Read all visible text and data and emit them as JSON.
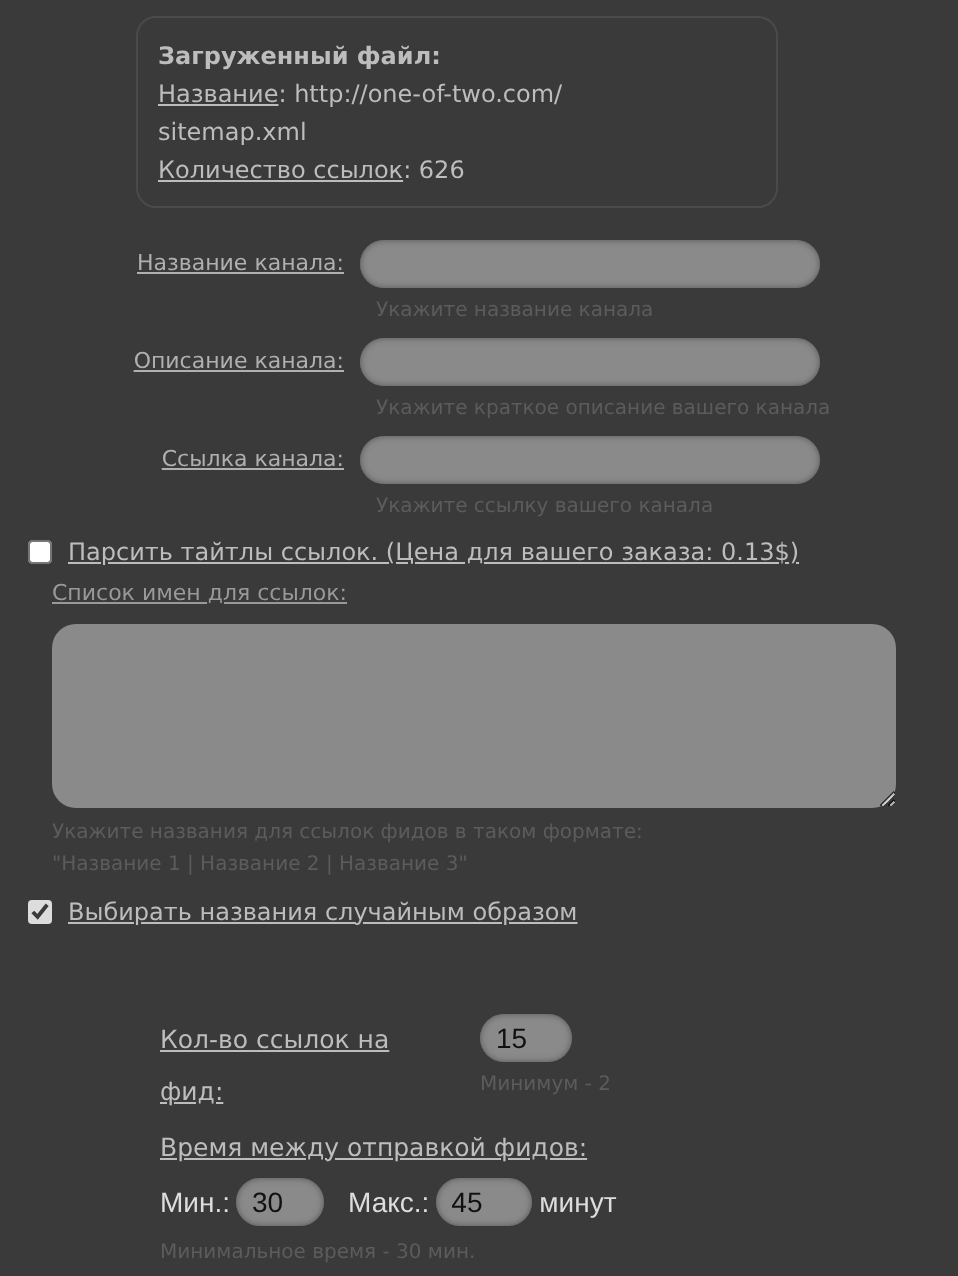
{
  "uploaded_file": {
    "title": "Загруженный файл:",
    "name_label": "Название",
    "name_value": ": http://one-of-two.com/",
    "name_value_cont": "sitemap.xml",
    "count_label": "Количество ссылок",
    "count_value": ": 626"
  },
  "channel_fields": [
    {
      "label": "Название канала:",
      "hint": "Укажите название канала"
    },
    {
      "label": "Описание канала:",
      "hint": "Укажите краткое описание вашего канала"
    },
    {
      "label": "Ссылка канала:",
      "hint": "Укажите ссылку вашего канала"
    }
  ],
  "parse_titles": {
    "label": "Парсить тайтлы ссылок. (Цена для вашего заказа: 0.13$)",
    "checked": false
  },
  "names_list": {
    "label": "Список имен для ссылок:",
    "hint_lines": [
      "Укажите названия для ссылок фидов в таком формате:",
      "\"Название 1 | Название 2 | Название 3\""
    ]
  },
  "random_names": {
    "label": "Выбирать названия случайным образом",
    "checked": true
  },
  "links_per_feed": {
    "label": "Кол-во ссылок на фид:",
    "value": "15",
    "hint": "Минимум - 2"
  },
  "feed_interval": {
    "label": "Время между отправкой фидов:",
    "min_label": "Мин.:",
    "min_value": "30",
    "max_label": "Макс.:",
    "max_value": "45",
    "unit": "минут",
    "hint": "Минимальное время - 30 мин."
  }
}
